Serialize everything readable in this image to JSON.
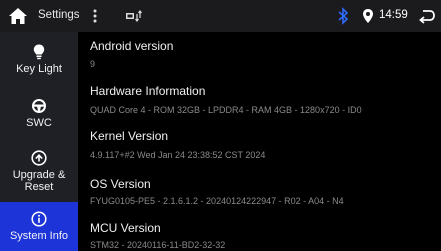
{
  "statusbar": {
    "title": "Settings",
    "time": "14:59",
    "icons": [
      "home-icon",
      "menu-dots-icon",
      "network-icon",
      "bluetooth-icon",
      "location-icon",
      "back-icon"
    ],
    "bluetooth_color": "#2f6bff"
  },
  "sidebar": {
    "accent": "#1d35d8",
    "items": [
      {
        "label": "Key Light",
        "icon": "lightbulb-icon"
      },
      {
        "label": "SWC",
        "icon": "steering-wheel-icon"
      },
      {
        "label": "Upgrade & Reset",
        "label_line1": "Upgrade &",
        "label_line2": "Reset",
        "icon": "upgrade-icon"
      },
      {
        "label": "System Info",
        "icon": "info-icon",
        "active": true
      }
    ]
  },
  "info": [
    {
      "title": "Android version",
      "value": "9"
    },
    {
      "title": "Hardware Information",
      "value": "QUAD Core 4 - ROM 32GB - LPDDR4 - RAM 4GB - 1280x720  - ID0"
    },
    {
      "title": "Kernel Version",
      "value": "4.9.117+#2 Wed Jan 24 23:38:52 CST 2024"
    },
    {
      "title": "OS Version",
      "value": "FYUG0105-PE5 - 2.1.6.1.2 - 20240124222947 - R02 - A04 - N4"
    },
    {
      "title": "MCU Version",
      "value": "STM32 - 20240116-11-BD2-32-32"
    }
  ]
}
